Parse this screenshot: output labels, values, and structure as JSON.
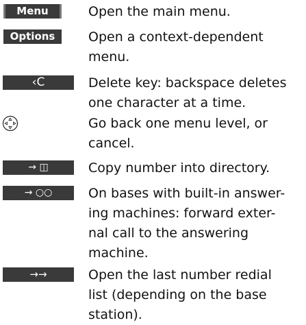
{
  "rows": [
    {
      "key": "Menu",
      "lines": [
        "Open the main menu."
      ]
    },
    {
      "key": "Options",
      "lines": [
        "Open a context-dependent",
        "menu."
      ]
    },
    {
      "key": "‹C",
      "lines": [
        "Delete key: backspace deletes",
        "one character at a time."
      ]
    },
    {
      "icon": "navigation-key-icon",
      "lines": [
        "Go back one menu level, or",
        "cancel."
      ]
    },
    {
      "key": "→ ◫",
      "lines": [
        "Copy number into directory."
      ]
    },
    {
      "key": "→ ○○",
      "lines": [
        "On bases with built-in answer-",
        "ing machines: forward exter-",
        "nal call to the answering",
        "machine."
      ]
    },
    {
      "key": "→→",
      "lines": [
        "Open the last number redial",
        "list (depending on the base",
        "station)."
      ]
    }
  ],
  "colors": {
    "key_background": "#3a3a3a",
    "key_edge": "#7a7a7a",
    "key_text": "#ffffff",
    "text": "#111111"
  }
}
